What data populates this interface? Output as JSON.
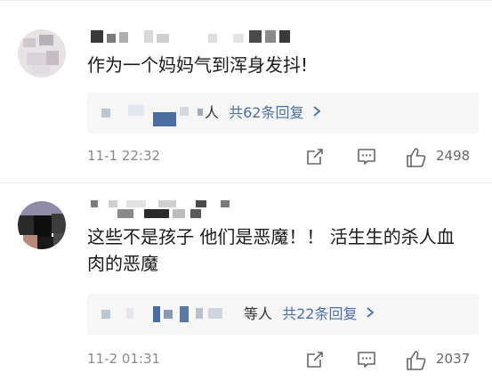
{
  "comments": [
    {
      "text": "作为一个妈妈气到浑身发抖!",
      "replies_suffix": "人",
      "replies_link": "共62条回复",
      "time": "11-1 22:32",
      "likes": "2498",
      "icons": {
        "share": "share-icon",
        "comment": "comment-icon",
        "like": "thumbs-up-icon",
        "chevron": "chevron-right-icon"
      }
    },
    {
      "text": "这些不是孩子 他们是恶魔！！ 活生生的杀人血肉的恶魔",
      "replies_suffix": "等人",
      "replies_link": "共22条回复",
      "time": "11-2 01:31",
      "likes": "2037",
      "icons": {
        "share": "share-icon",
        "comment": "comment-icon",
        "like": "thumbs-up-icon",
        "chevron": "chevron-right-icon"
      }
    }
  ],
  "colors": {
    "link": "#4a6fa8",
    "muted": "#8a8a8a",
    "reply_bg": "#f6f6f6",
    "divider": "#ececec"
  }
}
